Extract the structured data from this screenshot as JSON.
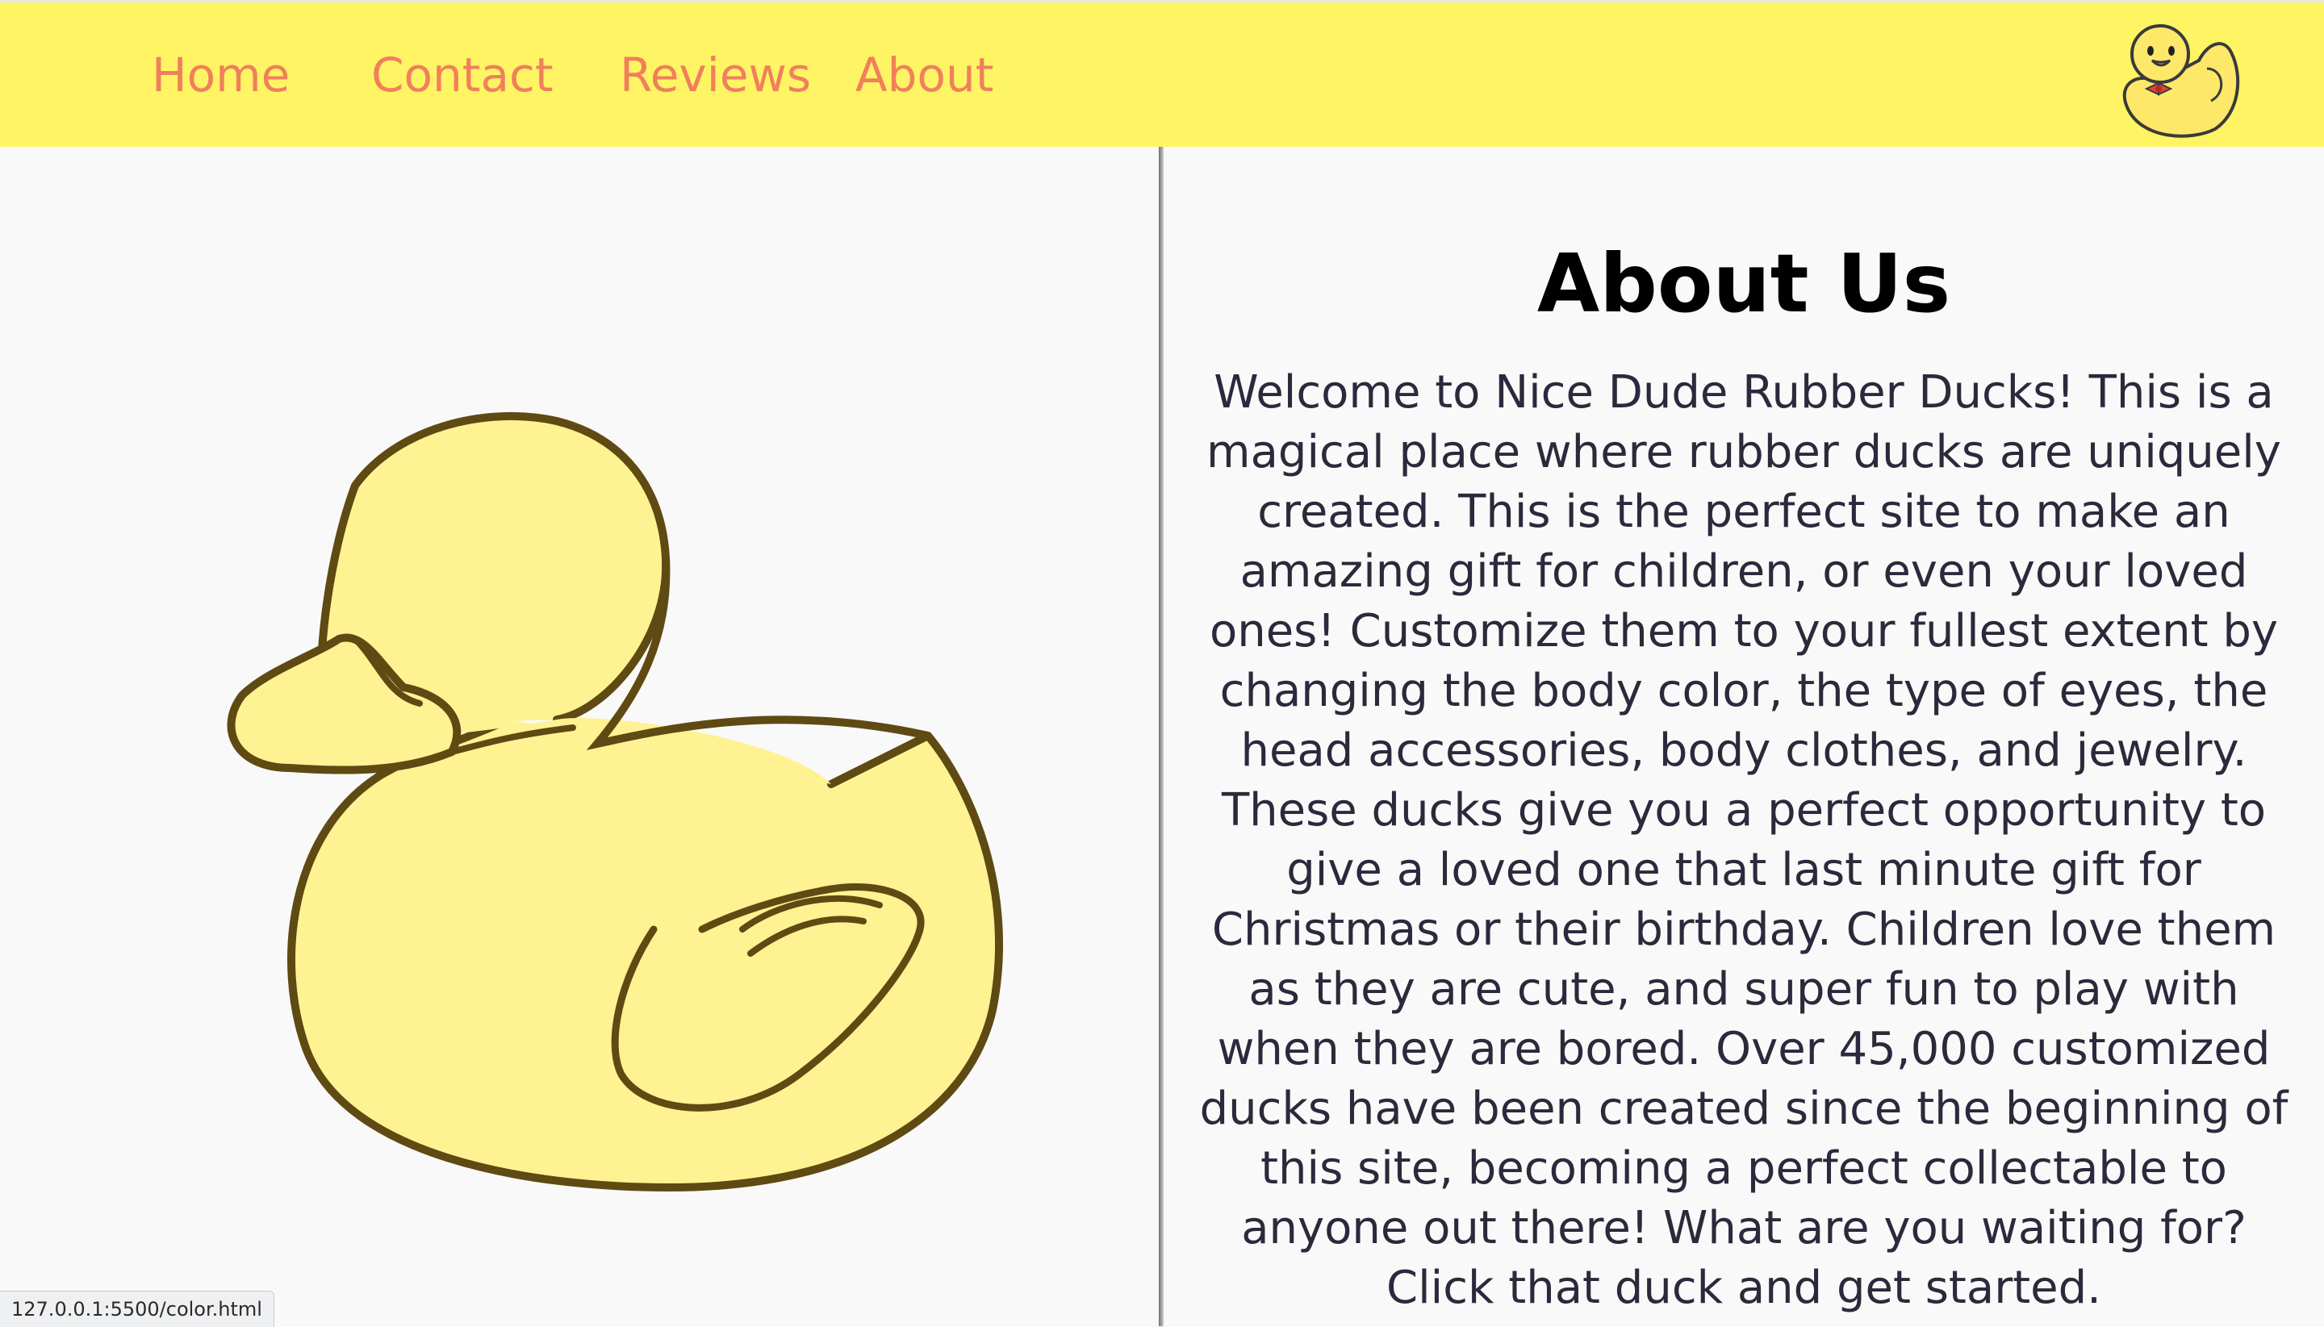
{
  "nav": {
    "home": "Home",
    "contact": "Contact",
    "reviews": "Reviews",
    "about": "About"
  },
  "about": {
    "title": "About Us",
    "body": "Welcome to Nice Dude Rubber Ducks! This is a magical place where rubber ducks are uniquely created. This is the perfect site to make an amazing gift for children, or even your loved ones! Customize them to your fullest extent by changing the body color, the type of eyes, the head accessories, body clothes, and jewelry. These ducks give you a perfect opportunity to give a loved one that last minute gift for Christmas or their birthday. Children love them as they are cute, and super fun to play with when they are bored. Over 45,000 customized ducks have been created since the beginning of this site, becoming a perfect collectable to anyone out there! What are you waiting for? Click that duck and get started."
  },
  "status_bar": {
    "url": "127.0.0.1:5500/color.html"
  },
  "colors": {
    "nav_background": "#fff464",
    "nav_link": "#f07f5b",
    "duck_body": "#fff293",
    "duck_outline": "#5e4a12"
  }
}
